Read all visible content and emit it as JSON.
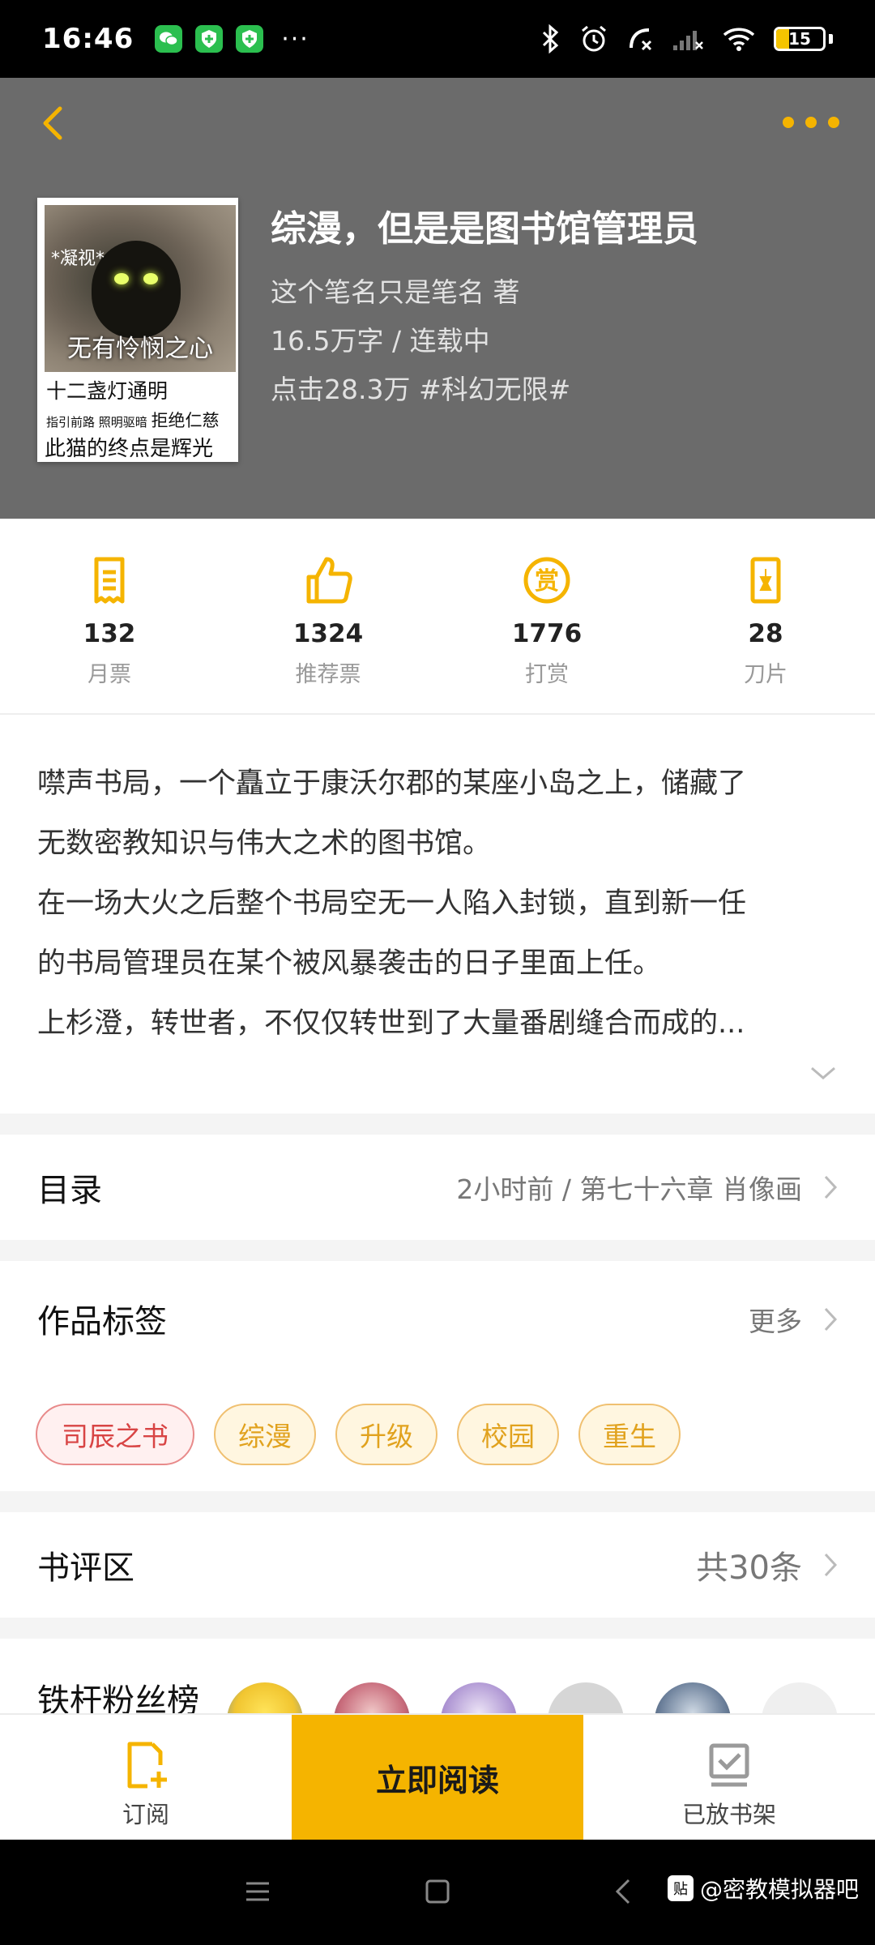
{
  "status_bar": {
    "time": "16:46",
    "more_indicator": "···",
    "battery_level": "15",
    "icons": [
      "wechat-icon",
      "shield-icon",
      "shield-icon",
      "bluetooth-icon",
      "alarm-icon",
      "missed-call-icon",
      "no-signal-icon",
      "wifi-icon",
      "battery-icon"
    ]
  },
  "header": {
    "back_icon": "chevron-left-icon",
    "more_icon": "more-dots-icon",
    "accent_color": "#f5b400"
  },
  "cover": {
    "top_text": "*凝视*",
    "mid_text": "无有怜悯之心",
    "line1": "十二盏灯通明",
    "line2_small": "指引前路 照明驱暗",
    "line2_big": "拒绝仁慈",
    "line3": "此猫的终点是辉光"
  },
  "book": {
    "title": "综漫，但是是图书馆管理员",
    "author_line": "这个笔名只是笔名  著",
    "words_status": "16.5万字 / 连载中",
    "clicks_tag": "点击28.3万  #科幻无限#"
  },
  "stats": [
    {
      "icon": "ticket-icon",
      "value": "132",
      "label": "月票"
    },
    {
      "icon": "thumbs-up-icon",
      "value": "1324",
      "label": "推荐票"
    },
    {
      "icon": "reward-icon",
      "value": "1776",
      "label": "打赏"
    },
    {
      "icon": "blade-icon",
      "value": "28",
      "label": "刀片"
    }
  ],
  "synopsis": {
    "lines": [
      "噤声书局，一个矗立于康沃尔郡的某座小岛之上，储藏了",
      "无数密教知识与伟大之术的图书馆。",
      "在一场大火之后整个书局空无一人陷入封锁，直到新一任",
      "的书局管理员在某个被风暴袭击的日子里面上任。",
      "上杉澄，转世者，不仅仅转世到了大量番剧缝合而成的..."
    ]
  },
  "catalog": {
    "title": "目录",
    "latest": "2小时前 / 第七十六章 肖像画"
  },
  "tags_section": {
    "title": "作品标签",
    "more": "更多",
    "tags": [
      "司辰之书",
      "综漫",
      "升级",
      "校园",
      "重生"
    ]
  },
  "reviews": {
    "title": "书评区",
    "count": "共30条"
  },
  "fans": {
    "title": "铁杆粉丝榜"
  },
  "bottom_bar": {
    "subscribe": "订阅",
    "read_now": "立即阅读",
    "on_shelf": "已放书架"
  },
  "watermark": {
    "icon_text": "贴",
    "text": "@密教模拟器吧"
  }
}
